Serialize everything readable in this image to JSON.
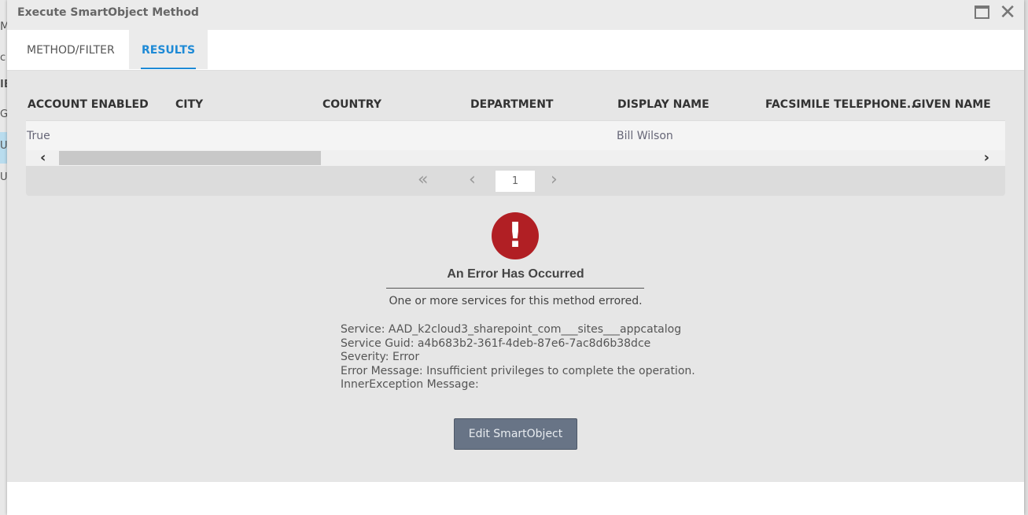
{
  "background": {
    "fragments": [
      "M",
      "c",
      "IE",
      "G",
      "Us",
      "Us"
    ]
  },
  "dialog": {
    "title": "Execute SmartObject Method",
    "maximize": "maximize",
    "close": "close"
  },
  "tabs": [
    {
      "label": "METHOD/FILTER"
    },
    {
      "label": "RESULTS",
      "active": true
    }
  ],
  "grid": {
    "columns": [
      "ACCOUNT ENABLED",
      "CITY",
      "COUNTRY",
      "DEPARTMENT",
      "DISPLAY NAME",
      "FACSIMILE TELEPHONE...",
      "GIVEN NAME"
    ],
    "rows": [
      [
        "True",
        "",
        "",
        "",
        "Bill Wilson",
        "",
        ""
      ]
    ]
  },
  "pager": {
    "page": "1"
  },
  "error": {
    "title": "An Error Has Occurred",
    "subtitle": "One or more services for this method errored.",
    "lines": [
      "Service: AAD_k2cloud3_sharepoint_com___sites___appcatalog",
      "Service Guid: a4b683b2-361f-4deb-87e6-7ac8d6b38dce",
      "Severity: Error",
      "Error Message: Insufficient privileges to complete the operation.",
      "InnerException Message:"
    ],
    "button": "Edit SmartObject"
  },
  "colors": {
    "accent": "#1e8ad6",
    "error": "#b11f24",
    "button": "#687486"
  }
}
